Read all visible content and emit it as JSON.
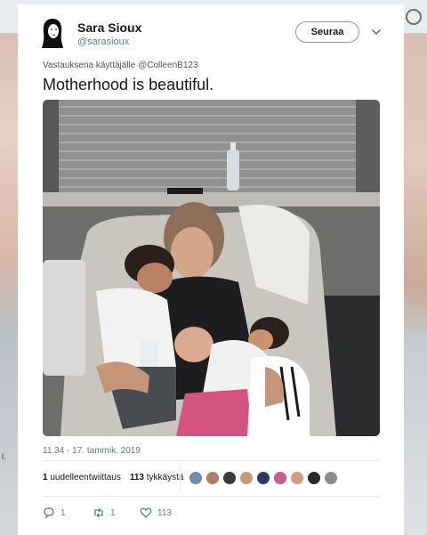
{
  "tweet": {
    "author_name": "Sara Sioux",
    "author_handle": "@sarasioux",
    "follow_label": "Seuraa",
    "reply_context": "Vastauksena käyttäjälle @ColleenB123",
    "text": "Motherhood is beautiful.",
    "timestamp": "11.34 - 17. tammik. 2019",
    "retweets_count": "1",
    "retweets_label": "uudelleentwiittaus",
    "likes_count": "113",
    "likes_label": "tykkäystä",
    "actions": {
      "reply_count": "1",
      "retweet_count": "1",
      "like_count": "113"
    },
    "liker_avatar_colors": [
      "#6c8ea8",
      "#b07c6a",
      "#3a3a3a",
      "#c79a7a",
      "#2b3a6b",
      "#c65a8c",
      "#d49a86",
      "#2a2a2a",
      "#8a8a8a"
    ]
  },
  "background": {
    "left_snippet": "l."
  },
  "icons": {
    "avatar": "drawn-woman-silhouette-icon",
    "menu": "chevron-down-icon",
    "reply": "reply-icon",
    "retweet": "retweet-icon",
    "like": "heart-icon"
  }
}
